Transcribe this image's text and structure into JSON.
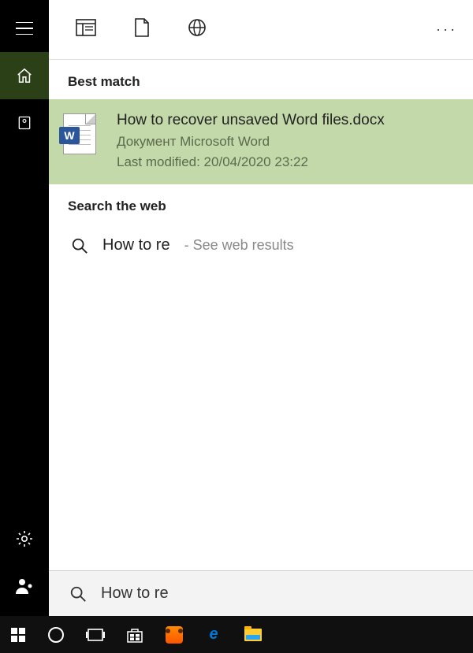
{
  "sections": {
    "best_match": "Best match",
    "search_web": "Search the web"
  },
  "result": {
    "title": "How to recover unsaved Word files.docx",
    "subtitle": "Документ Microsoft Word",
    "meta": "Last modified: 20/04/2020 23:22",
    "badge": "W"
  },
  "web": {
    "query": "How to re",
    "hint": "- See web results"
  },
  "search": {
    "value": "How to re"
  },
  "icons": {
    "hamburger": "hamburger-icon",
    "home": "home-icon",
    "recent": "recent-icon",
    "settings": "settings-icon",
    "user": "user-icon",
    "filter_all": "all-results-icon",
    "filter_docs": "documents-icon",
    "filter_web": "web-icon",
    "more": "···",
    "search": "search-icon"
  },
  "taskbar": {
    "start": "start-icon",
    "cortana": "cortana-icon",
    "taskview": "taskview-icon",
    "store": "store-icon",
    "uc": "uc-browser-icon",
    "edge": "edge-icon",
    "explorer": "file-explorer-icon"
  }
}
